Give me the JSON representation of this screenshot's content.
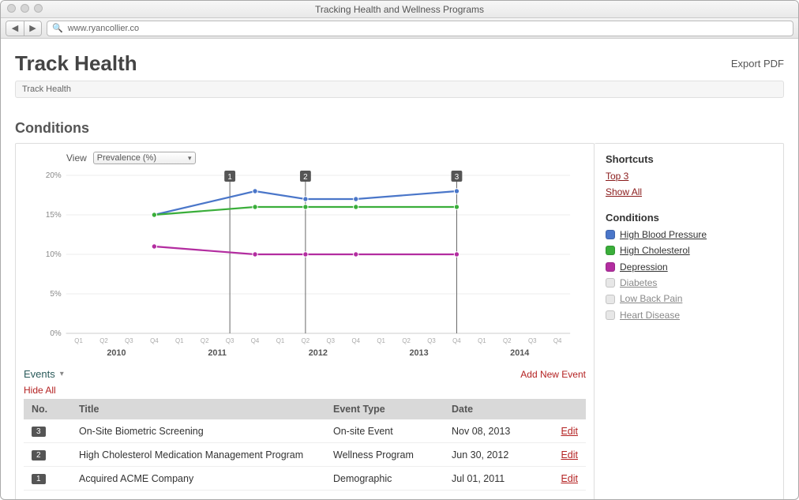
{
  "window": {
    "title": "Tracking Health and Wellness Programs",
    "url": "www.ryancollier.co"
  },
  "header": {
    "page_title": "Track Health",
    "export_label": "Export PDF"
  },
  "breadcrumb": {
    "text": "Track Health"
  },
  "section": {
    "title": "Conditions"
  },
  "view": {
    "label": "View",
    "selected": "Prevalence (%)"
  },
  "shortcuts": {
    "heading": "Shortcuts",
    "top3": "Top 3",
    "showall": "Show All"
  },
  "conditions_panel": {
    "heading": "Conditions",
    "items": [
      {
        "label": "High Blood Pressure",
        "color": "#4a76c9",
        "active": true
      },
      {
        "label": "High Cholesterol",
        "color": "#3aae3a",
        "active": true
      },
      {
        "label": "Depression",
        "color": "#b32da0",
        "active": true
      },
      {
        "label": "Diabetes",
        "color": "#e7e7e7",
        "active": false
      },
      {
        "label": "Low Back Pain",
        "color": "#e7e7e7",
        "active": false
      },
      {
        "label": "Heart Disease",
        "color": "#e7e7e7",
        "active": false
      }
    ]
  },
  "events_section": {
    "label": "Events",
    "add_new": "Add New Event",
    "hide_all": "Hide All",
    "columns": {
      "no": "No.",
      "title": "Title",
      "type": "Event Type",
      "date": "Date",
      "edit": ""
    },
    "rows": [
      {
        "no": "3",
        "title": "On-Site Biometric Screening",
        "type": "On-site Event",
        "date": "Nov 08, 2013",
        "edit": "Edit"
      },
      {
        "no": "2",
        "title": "High Cholesterol Medication Management Program",
        "type": "Wellness Program",
        "date": "Jun 30, 2012",
        "edit": "Edit"
      },
      {
        "no": "1",
        "title": "Acquired ACME Company",
        "type": "Demographic",
        "date": "Jul 01, 2011",
        "edit": "Edit"
      }
    ]
  },
  "chart_data": {
    "type": "line",
    "ylabel": "",
    "ylim": [
      0,
      20
    ],
    "y_ticks": [
      0,
      5,
      10,
      15,
      20
    ],
    "y_tick_labels": [
      "0%",
      "5%",
      "10%",
      "15%",
      "20%"
    ],
    "x_years": [
      "2010",
      "2011",
      "2012",
      "2013",
      "2014"
    ],
    "x_ticks_per_year": [
      "Q1",
      "Q2",
      "Q3",
      "Q4"
    ],
    "first_x_index": 3,
    "last_x_index": 15,
    "series": [
      {
        "name": "High Blood Pressure",
        "color": "#4a76c9",
        "x": [
          3,
          7,
          9,
          11,
          15
        ],
        "values": [
          15,
          18,
          17,
          17,
          18
        ]
      },
      {
        "name": "High Cholesterol",
        "color": "#3aae3a",
        "x": [
          3,
          7,
          9,
          11,
          15
        ],
        "values": [
          15,
          16,
          16,
          16,
          16
        ]
      },
      {
        "name": "Depression",
        "color": "#b32da0",
        "x": [
          3,
          7,
          9,
          11,
          15
        ],
        "values": [
          11,
          10,
          10,
          10,
          10
        ]
      }
    ],
    "event_markers": [
      {
        "label": "1",
        "x": 6
      },
      {
        "label": "2",
        "x": 9
      },
      {
        "label": "3",
        "x": 15
      }
    ]
  }
}
